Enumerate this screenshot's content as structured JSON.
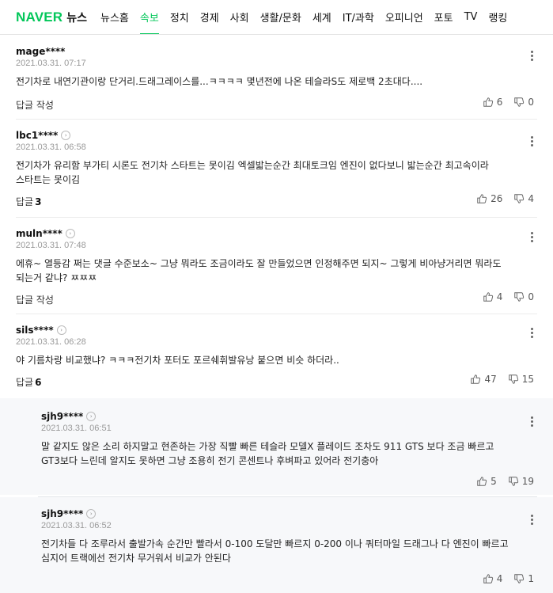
{
  "nav": {
    "logo": "NAVER",
    "logo_suffix": "뉴스",
    "items": [
      "뉴스홈",
      "속보",
      "정치",
      "경제",
      "사회",
      "생활/문화",
      "세계",
      "IT/과학",
      "오피니언",
      "포토",
      "TV",
      "랭킹"
    ],
    "active_index": 1,
    "accent_color": "#03c75a"
  },
  "comments": [
    {
      "author": "mage****",
      "date": "2021.03.31. 07:17",
      "text": "전기차로 내연기관이랑 단거리.드래그레이스를...ㅋㅋㅋㅋ 몇년전에 나온 테슬라S도 제로백 2초대다....",
      "reply_label": "답글 작성",
      "reply_count": "",
      "likes": "6",
      "dislikes": "0"
    },
    {
      "author": "lbc1****",
      "date": "2021.03.31. 06:58",
      "text": "전기차가 유리함 부가티 시론도 전기차 스타트는 못이김 엑셀밟는순간 최대토크임 엔진이 없다보니 밟는순간 최고속이라 스타트는 못이김",
      "reply_label": "답글",
      "reply_count": "3",
      "likes": "26",
      "dislikes": "4"
    },
    {
      "author": "muln****",
      "date": "2021.03.31. 07:48",
      "text": "에휴~ 열등감 쩌는 댓글 수준보소~ 그냥 뭐라도 조금이라도 잘 만들었으면 인정해주면 되지~ 그렇게 비아냥거리면 뭐라도 되는거 같냐? ㅉㅉㅉ",
      "reply_label": "답글 작성",
      "reply_count": "",
      "likes": "4",
      "dislikes": "0"
    },
    {
      "author": "sils****",
      "date": "2021.03.31. 06:28",
      "text": "야 기름차랑 비교했냐? ㅋㅋㅋ전기차 포터도 포르쉐휘발유낭 붙으면 비슷 하더라..",
      "reply_label": "답글",
      "reply_count": "6",
      "likes": "47",
      "dislikes": "15"
    }
  ],
  "replies": [
    {
      "author": "sjh9****",
      "date": "2021.03.31. 06:51",
      "text": "말 같지도 않은 소리 하지말고 현존하는 가장 직빨 빠른 테슬라 모델X 플레이드 조차도 911 GTS 보다 조금 빠르고 GT3보다 느린데 알지도 못하면 그냥 조용히 전기 콘센트나 후벼파고 있어라 전기충아",
      "likes": "5",
      "dislikes": "19"
    },
    {
      "author": "sjh9****",
      "date": "2021.03.31. 06:52",
      "text": "전기차들 다 조루라서 출발가속 순간만 빨라서 0-100 도달만 빠르지 0-200 이나 쿼터마일 드래그나 다 엔진이 빠르고 심지어 트랙에선 전기차 무거워서 비교가 안된다",
      "likes": "4",
      "dislikes": "1"
    }
  ]
}
